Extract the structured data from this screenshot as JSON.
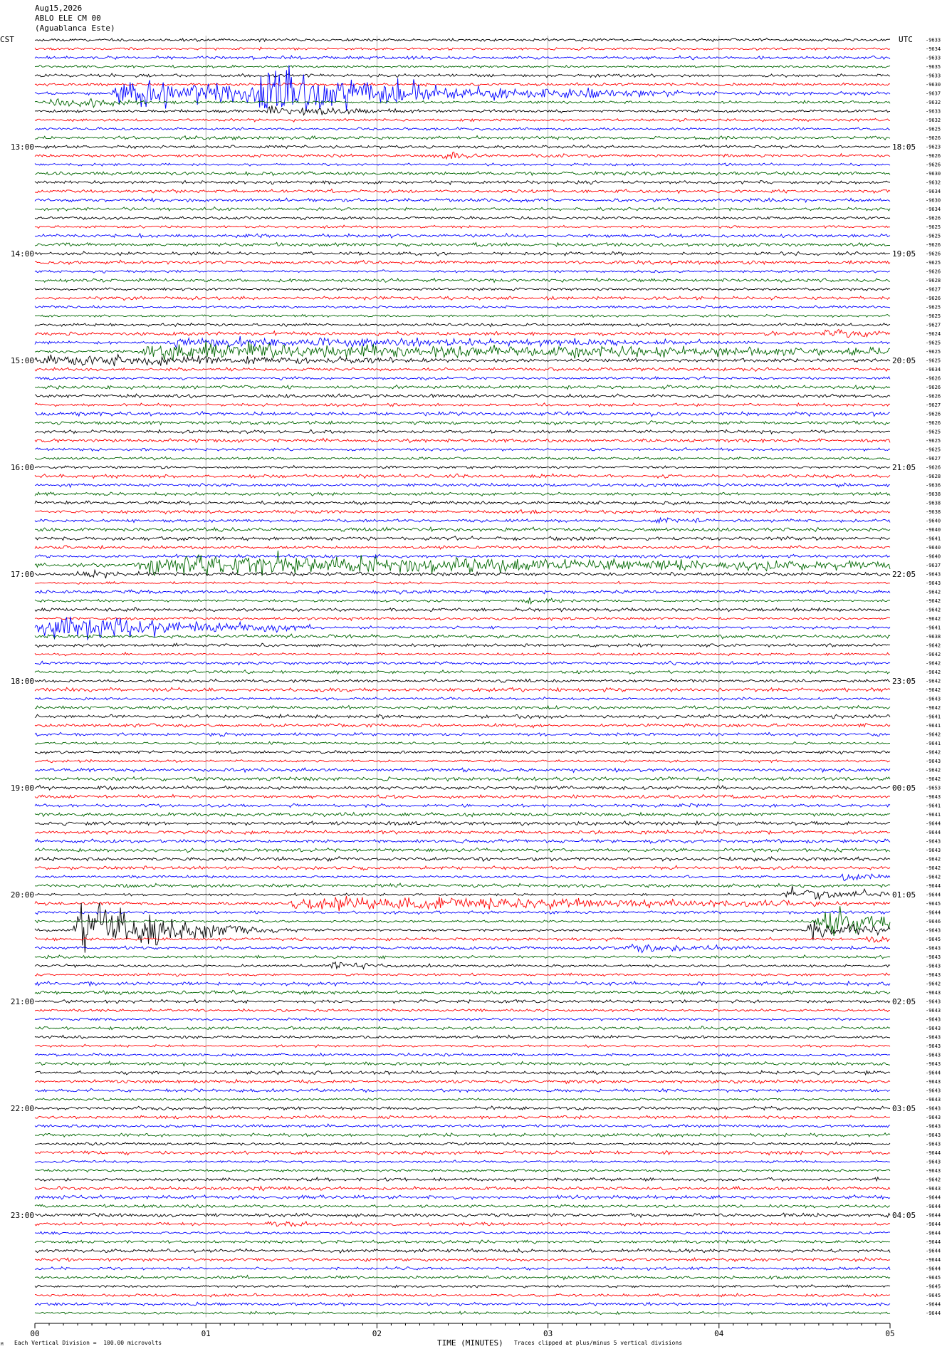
{
  "header": {
    "date": "Aug15,2026",
    "station": "ABLO ELE CM 00",
    "site": "(Aguablanca Este)",
    "left_tz": "CST",
    "right_tz": "UTC"
  },
  "footer": {
    "scale_note": "Each Vertical Division =  100.00 microvolts",
    "xlabel": "TIME (MINUTES)",
    "clip_note": "Traces clipped at plus/minus 5 vertical divisions",
    "corner_mark": "M"
  },
  "chart_data": {
    "type": "line",
    "title": "ABLO ELE CM 00 (Aguablanca Este) Aug15,2026",
    "xlabel": "TIME (MINUTES)",
    "xlim": [
      0,
      5
    ],
    "x_ticks": [
      "00",
      "01",
      "02",
      "03",
      "04",
      "05"
    ],
    "trace_colors": [
      "#000000",
      "#ff0000",
      "#0000ff",
      "#006600"
    ],
    "trace_count": 144,
    "left_hour_labels": [
      "13:00",
      "14:00",
      "15:00",
      "16:00",
      "17:00",
      "18:00",
      "19:00",
      "20:00",
      "21:00",
      "22:00",
      "23:00"
    ],
    "right_hour_labels": [
      "18:05",
      "19:05",
      "20:05",
      "21:05",
      "22:05",
      "23:05",
      "00:05",
      "01:05",
      "02:05",
      "03:05",
      "04:05"
    ],
    "first_label_trace": 12,
    "label_every": 12,
    "right_values": [
      "-9633",
      "-9634",
      "-9633",
      "-9635",
      "-9633",
      "-9630",
      "-9637",
      "-9632",
      "-9633",
      "-9632",
      "-9625",
      "-9626",
      "-9623",
      "-9626",
      "-9626",
      "-9630",
      "-9632",
      "-9634",
      "-9630",
      "-9634",
      "-9626",
      "-9625",
      "-9625",
      "-9626",
      "-9626",
      "-9625",
      "-9626",
      "-9628",
      "-9627",
      "-9626",
      "-9625",
      "-9625",
      "-9627",
      "-9624",
      "-9625",
      "-9625",
      "-9625",
      "-9634",
      "-9626",
      "-9626",
      "-9626",
      "-9627",
      "-9626",
      "-9626",
      "-9625",
      "-9625",
      "-9625",
      "-9627",
      "-9626",
      "-9628",
      "-9636",
      "-9638",
      "-9638",
      "-9638",
      "-9640",
      "-9640",
      "-9641",
      "-9640",
      "-9640",
      "-9637",
      "-9643",
      "-9643",
      "-9642",
      "-9642",
      "-9642",
      "-9642",
      "-9641",
      "-9638",
      "-9642",
      "-9642",
      "-9642",
      "-9642",
      "-9642",
      "-9642",
      "-9643",
      "-9642",
      "-9641",
      "-9641",
      "-9642",
      "-9641",
      "-9642",
      "-9643",
      "-9642",
      "-9642",
      "-9653",
      "-9643",
      "-9641",
      "-9641",
      "-9644",
      "-9644",
      "-9643",
      "-9643",
      "-9642",
      "-9642",
      "-9642",
      "-9644",
      "-9644",
      "-9645",
      "-9644",
      "-9646",
      "-9643",
      "-9645",
      "-9643",
      "-9643",
      "-9643",
      "-9643",
      "-9642",
      "-9643",
      "-9643",
      "-9643",
      "-9643",
      "-9643",
      "-9643",
      "-9643",
      "-9643",
      "-9643",
      "-9644",
      "-9643",
      "-9643",
      "-9643",
      "-9643",
      "-9643",
      "-9643",
      "-9643",
      "-9643",
      "-9644",
      "-9643",
      "-9643",
      "-9642",
      "-9643",
      "-9644",
      "-9644",
      "-9644",
      "-9644",
      "-9644",
      "-9644",
      "-9644",
      "-9644",
      "-9644",
      "-9645",
      "-9645",
      "-9645",
      "-9644",
      "-9644"
    ],
    "events": [
      {
        "trace": 6,
        "x": 0.45,
        "dur": 3.2,
        "amp": 14,
        "decay": 1.6
      },
      {
        "trace": 6,
        "x": 1.3,
        "dur": 0.9,
        "amp": 30,
        "decay": 0.8
      },
      {
        "trace": 7,
        "x": 0.05,
        "dur": 0.6,
        "amp": 5,
        "decay": 0.6
      },
      {
        "trace": 8,
        "x": 1.35,
        "dur": 0.6,
        "amp": 6,
        "decay": 0.5
      },
      {
        "trace": 13,
        "x": 2.36,
        "dur": 0.12,
        "amp": 6,
        "decay": 0.1
      },
      {
        "trace": 33,
        "x": 4.6,
        "dur": 0.2,
        "amp": 6,
        "decay": 0.2
      },
      {
        "trace": 34,
        "x": 0.8,
        "dur": 3.0,
        "amp": 5,
        "decay": 2.5
      },
      {
        "trace": 35,
        "x": 0.6,
        "dur": 4.4,
        "amp": 9,
        "decay": 3.0
      },
      {
        "trace": 36,
        "x": 0.0,
        "dur": 2.0,
        "amp": 5,
        "decay": 1.5
      },
      {
        "trace": 54,
        "x": 3.6,
        "dur": 0.08,
        "amp": 4,
        "decay": 0.1
      },
      {
        "trace": 59,
        "x": 0.6,
        "dur": 4.3,
        "amp": 11,
        "decay": 3.0
      },
      {
        "trace": 60,
        "x": 0.22,
        "dur": 0.3,
        "amp": 4,
        "decay": 0.3
      },
      {
        "trace": 63,
        "x": 2.85,
        "dur": 0.1,
        "amp": 4,
        "decay": 0.1
      },
      {
        "trace": 66,
        "x": 0.0,
        "dur": 1.4,
        "amp": 13,
        "decay": 1.0
      },
      {
        "trace": 66,
        "x": 0.4,
        "dur": 0.5,
        "amp": 12,
        "decay": 0.5
      },
      {
        "trace": 94,
        "x": 4.7,
        "dur": 0.3,
        "amp": 4,
        "decay": 0.3
      },
      {
        "trace": 96,
        "x": 4.34,
        "dur": 0.65,
        "amp": 6,
        "decay": 0.5
      },
      {
        "trace": 97,
        "x": 1.45,
        "dur": 3.0,
        "amp": 7,
        "decay": 2.5
      },
      {
        "trace": 100,
        "x": 0.22,
        "dur": 0.9,
        "amp": 30,
        "decay": 0.6
      },
      {
        "trace": 100,
        "x": 4.5,
        "dur": 0.35,
        "amp": 10,
        "decay": 0.4
      },
      {
        "trace": 99,
        "x": 4.55,
        "dur": 0.4,
        "amp": 22,
        "decay": 0.4
      },
      {
        "trace": 102,
        "x": 3.45,
        "dur": 0.4,
        "amp": 6,
        "decay": 0.3
      },
      {
        "trace": 101,
        "x": 4.85,
        "dur": 0.1,
        "amp": 6,
        "decay": 0.1
      },
      {
        "trace": 104,
        "x": 1.7,
        "dur": 0.25,
        "amp": 6,
        "decay": 0.2
      },
      {
        "trace": 133,
        "x": 1.35,
        "dur": 0.1,
        "amp": 3,
        "decay": 0.1
      }
    ]
  }
}
